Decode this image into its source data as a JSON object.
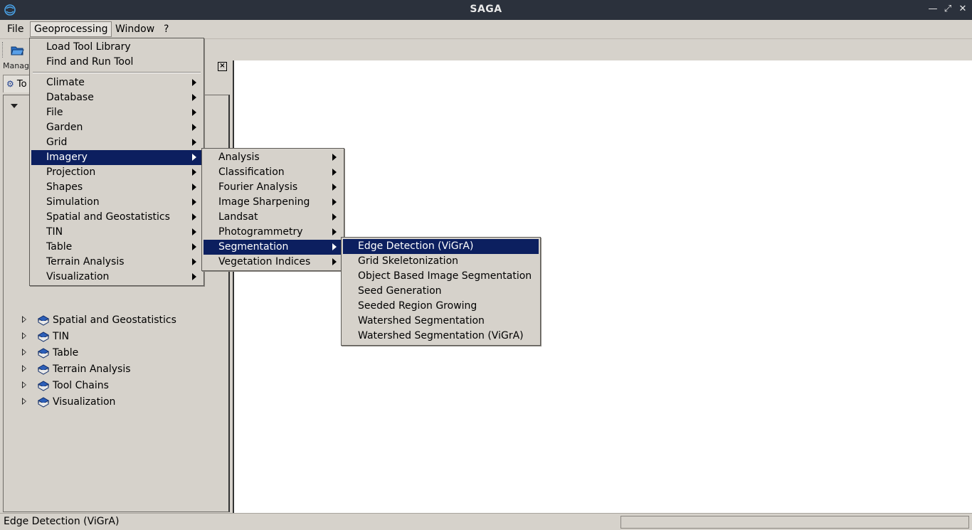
{
  "window": {
    "title": "SAGA"
  },
  "menubar": [
    {
      "label": "File"
    },
    {
      "label": "Geoprocessing",
      "open": true
    },
    {
      "label": "Window"
    },
    {
      "label": "?"
    }
  ],
  "manager": {
    "header": "Manag",
    "tab_label": "To"
  },
  "tree_items": [
    {
      "label": "Spatial and Geostatistics"
    },
    {
      "label": "TIN"
    },
    {
      "label": "Table"
    },
    {
      "label": "Terrain Analysis"
    },
    {
      "label": "Tool Chains"
    },
    {
      "label": "Visualization"
    }
  ],
  "geoprocessing_menu": {
    "top_items": [
      "Load Tool Library",
      "Find and Run Tool"
    ],
    "items": [
      {
        "label": "Climate"
      },
      {
        "label": "Database"
      },
      {
        "label": "File"
      },
      {
        "label": "Garden"
      },
      {
        "label": "Grid"
      },
      {
        "label": "Imagery",
        "selected": true
      },
      {
        "label": "Projection"
      },
      {
        "label": "Shapes"
      },
      {
        "label": "Simulation"
      },
      {
        "label": "Spatial and Geostatistics"
      },
      {
        "label": "TIN"
      },
      {
        "label": "Table"
      },
      {
        "label": "Terrain Analysis"
      },
      {
        "label": "Visualization"
      }
    ]
  },
  "imagery_menu": {
    "items": [
      {
        "label": "Analysis"
      },
      {
        "label": "Classification"
      },
      {
        "label": "Fourier Analysis"
      },
      {
        "label": "Image Sharpening"
      },
      {
        "label": "Landsat"
      },
      {
        "label": "Photogrammetry"
      },
      {
        "label": "Segmentation",
        "selected": true
      },
      {
        "label": "Vegetation Indices"
      }
    ]
  },
  "segmentation_menu": {
    "items": [
      {
        "label": "Edge Detection (ViGrA)",
        "selected": true
      },
      {
        "label": "Grid Skeletonization"
      },
      {
        "label": "Object Based Image Segmentation"
      },
      {
        "label": "Seed Generation"
      },
      {
        "label": "Seeded Region Growing"
      },
      {
        "label": "Watershed Segmentation"
      },
      {
        "label": "Watershed Segmentation (ViGrA)"
      }
    ]
  },
  "statusbar": {
    "text": "Edge Detection (ViGrA)"
  },
  "colors": {
    "selection": "#0c1f5f",
    "titlebar": "#2b313c",
    "background": "#d6d2cb"
  }
}
